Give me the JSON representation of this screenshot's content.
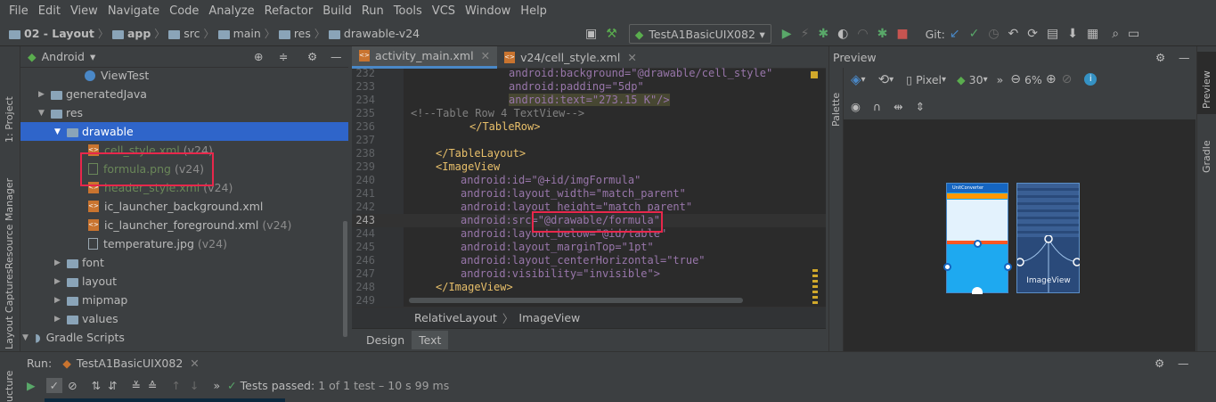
{
  "menu": [
    "File",
    "Edit",
    "View",
    "Navigate",
    "Code",
    "Analyze",
    "Refactor",
    "Build",
    "Run",
    "Tools",
    "VCS",
    "Window",
    "Help"
  ],
  "breadcrumb": [
    "02 - Layout",
    "app",
    "src",
    "main",
    "res",
    "drawable-v24"
  ],
  "toolbar": {
    "run_config": "TestA1BasicUIX082",
    "git_label": "Git:"
  },
  "left_strip": {
    "project": "1: Project",
    "resource_manager": "Resource Manager",
    "layout_captures": "Layout Captures",
    "structure": "ucture"
  },
  "project_panel": {
    "view_mode": "Android"
  },
  "tree": {
    "viewtest": "ViewTest",
    "generated_java": "generatedJava",
    "res": "res",
    "drawable": "drawable",
    "cell_style": "cell_style.xml",
    "formula": "formula.png",
    "header_style": "header_style.xml",
    "ic_bg": "ic_launcher_background.xml",
    "ic_fg": "ic_launcher_foreground.xml",
    "temperature": "temperature.jpg",
    "font": "font",
    "layout": "layout",
    "mipmap": "mipmap",
    "values": "values",
    "gradle": "Gradle Scripts",
    "v24": "(v24)"
  },
  "editor": {
    "tab1": "activity_main.xml",
    "tab2": "v24/cell_style.xml",
    "crumb1": "RelativeLayout",
    "crumb2": "ImageView",
    "design_tab": "Design",
    "text_tab": "Text"
  },
  "code": {
    "l232": "android:background=\"@drawable/cell_style\"",
    "l233": "android:padding=\"5dp\"",
    "l234": "android:text=\"273.15 K\"/>",
    "l235": "<!--Table Row 4 TextView-->",
    "l236": "</TableRow>",
    "l237": "",
    "l238": "</TableLayout>",
    "l239": "<ImageView",
    "l240": "android:id=\"@+id/imgFormula\"",
    "l241": "android:layout_width=\"match_parent\"",
    "l242": "android:layout_height=\"match_parent\"",
    "l243": "android:src=\"@drawable/formula\"",
    "l244": "android:layout_below=\"@id/table\"",
    "l245": "android:layout_marginTop=\"1pt\"",
    "l246": "android:layout_centerHorizontal=\"true\"",
    "l247": "android:visibility=\"invisible\">",
    "l248": "</ImageView>",
    "l249": "",
    "line_numbers": [
      "232",
      "233",
      "234",
      "235",
      "236",
      "237",
      "238",
      "239",
      "240",
      "241",
      "242",
      "243",
      "244",
      "245",
      "246",
      "247",
      "248",
      "249"
    ]
  },
  "preview": {
    "title": "Preview",
    "palette": "Palette",
    "device": "Pixel",
    "api": "30",
    "zoom": "6%",
    "phone_title": "UnitConverter",
    "blueprint_label": "ImageView"
  },
  "right_strip": {
    "preview": "Preview",
    "gradle": "Gradle"
  },
  "run_panel": {
    "label": "Run:",
    "config": "TestA1BasicUIX082",
    "status_bold": "Tests passed:",
    "status_rest": "1 of 1 test – 10 s 99 ms"
  },
  "colors": {
    "accent": "#4a88c7",
    "highlight_box": "#e8274b",
    "selected_row": "#2f65ca",
    "phone_blue": "#1ea9f0"
  }
}
